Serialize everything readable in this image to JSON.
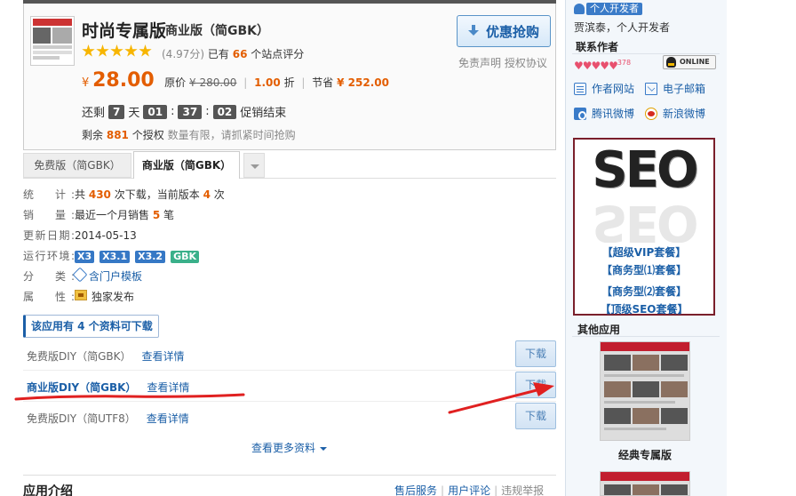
{
  "product": {
    "title": "时尚专属版",
    "edition": "商业版（简GBK）",
    "rating": {
      "stars": 5,
      "score_text": "(4.97分)",
      "prefix": "已有",
      "count": "66",
      "suffix": "个站点评分"
    },
    "price": {
      "currency": "¥",
      "current": "28.00",
      "orig_label": "原价",
      "orig": "¥ 280.00",
      "discount": "1.00",
      "discount_unit": "折",
      "save_label": "节省",
      "save": "¥ 252.00"
    },
    "buy_label": "优惠抢购",
    "disclaimer": "免责声明 授权协议",
    "countdown": {
      "prefix": "还剩",
      "days": "7",
      "day_unit": "天",
      "hours": "01",
      "minutes": "37",
      "seconds": "02",
      "suffix": "促销结束"
    },
    "remaining": {
      "prefix": "剩余",
      "count": "881",
      "unit": "个授权",
      "note": "数量有限，请抓紧时间抢购"
    }
  },
  "tabs": [
    {
      "label": "免费版（简GBK）"
    },
    {
      "label": "商业版（简GBK）"
    }
  ],
  "info": {
    "stats_label": "统　计:",
    "stats_a": "共",
    "stats_total": "430",
    "stats_b": "次下载，当前版本",
    "stats_current": "4",
    "stats_c": "次",
    "sales_label": "销　量:",
    "sales_a": "最近一个月销售",
    "sales_count": "5",
    "sales_b": "笔",
    "date_label": "更新日期:",
    "date_value": "2014-05-13",
    "env_label": "运行环境:",
    "env": [
      "X3",
      "X3.1",
      "X3.2",
      "GBK"
    ],
    "cat_label": "分　类:",
    "cat_value": "含门户模板",
    "attr_label": "属　性:",
    "attr_value": "独家发布"
  },
  "downloads": {
    "header": "该应用有 4 个资料可下载",
    "items": [
      {
        "name": "免费版DIY（简GBK）",
        "detail": "查看详情",
        "button": "下载"
      },
      {
        "name": "商业版DIY（简GBK）",
        "detail": "查看详情",
        "button": "下载"
      },
      {
        "name": "免费版DIY（简UTF8）",
        "detail": "查看详情",
        "button": "下载"
      }
    ],
    "more": "查看更多资料"
  },
  "bottom": {
    "intro": "应用介绍",
    "links": [
      "售后服务",
      "用户评论",
      "违规举报"
    ]
  },
  "sidebar": {
    "dev_badge": "个人开发者",
    "dev_name": "贾滨泰，个人开发者",
    "contact_header": "联系作者",
    "heart_count": "378",
    "online": "ONLINE",
    "links": {
      "website": "作者网站",
      "email": "电子邮箱",
      "tencent": "腾讯微博",
      "sina": "新浪微博"
    },
    "seo": {
      "text": "SEO",
      "packages": [
        "【超级VIP套餐】",
        "【商务型⑴套餐】",
        "【商务型⑵套餐】",
        "【顶级SEO套餐】"
      ]
    },
    "other_header": "其他应用",
    "apps": [
      {
        "name": "经典专属版"
      }
    ]
  },
  "colors": {
    "accent": "#1b5fa7",
    "price": "#e35d00",
    "annotation": "#e02020"
  }
}
